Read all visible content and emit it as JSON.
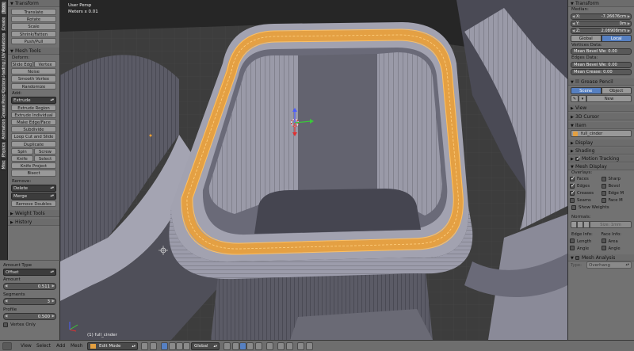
{
  "left_tabs": [
    "Tools",
    "Create",
    "Relations",
    "Shading / UVs",
    "Options",
    "Grease Pencil",
    "Animation",
    "Physics",
    "Misc"
  ],
  "shelf": {
    "transform": {
      "title": "Transform",
      "buttons": [
        "Translate",
        "Rotate",
        "Scale",
        "Shrink/Fatten",
        "Push/Pull"
      ]
    },
    "mesh_tools": {
      "title": "Mesh Tools",
      "deform_label": "Deform:",
      "slide_edge": "Slide Edg",
      "vertex": "Vertex",
      "deform_buttons": [
        "Noise",
        "Smooth Vertex",
        "Randomize"
      ],
      "add_label": "Add:",
      "extrude_select": "Extrude",
      "add_buttons": [
        "Extrude Region",
        "Extrude Individual",
        "Make Edge/Face",
        "Subdivide",
        "Loop Cut and Slide",
        "Duplicate"
      ],
      "spin": "Spin",
      "screw": "Screw",
      "knife": "Knife",
      "select": "Select",
      "add_buttons2": [
        "Knife Project",
        "Bisect"
      ],
      "remove_label": "Remove:",
      "delete_select": "Delete",
      "merge_select": "Merge",
      "remove_doubles": "Remove Doubles"
    },
    "weight_tools": "Weight Tools",
    "history": "History"
  },
  "operator": {
    "amount_type_label": "Amount Type",
    "amount_type": "Offset",
    "amount_label": "Amount",
    "amount_value": "0.511",
    "segments_label": "Segments",
    "segments_value": "3",
    "profile_label": "Profile",
    "profile_value": "0.500",
    "vertex_only": "Vertex Only"
  },
  "viewport": {
    "view_name": "User Persp",
    "scale": "Meters x 0.01",
    "object_info": "(1) full_cinder"
  },
  "rpanel": {
    "transform_title": "Transform",
    "median_label": "Median:",
    "x_label": "X:",
    "x_value": "-7.26676cm",
    "y_label": "Y:",
    "y_value": "0m",
    "z_label": "Z:",
    "z_value": "2.08908mm",
    "global": "Global",
    "local": "Local",
    "vertices_data_label": "Vertices Data:",
    "vert_bevel": "Mean Bevel We: 0.00",
    "edges_data_label": "Edges Data:",
    "edge_bevel": "Mean Bevel We: 0.00",
    "edge_crease": "Mean Crease: 0.00",
    "grease_pencil": "Grease Pencil",
    "scene": "Scene",
    "object": "Object",
    "new": "New",
    "view": "View",
    "cursor_3d": "3D Cursor",
    "item": "Item",
    "item_name": "full_cinder",
    "display": "Display",
    "shading": "Shading",
    "motion_tracking": "Motion Tracking",
    "mesh_display": "Mesh Display",
    "overlays_label": "Overlays:",
    "overlays": [
      {
        "label": "Faces",
        "checked": true
      },
      {
        "label": "Sharp",
        "checked": false
      },
      {
        "label": "Edges",
        "checked": true
      },
      {
        "label": "Bevel",
        "checked": false
      },
      {
        "label": "Creases",
        "checked": true
      },
      {
        "label": "Edge M",
        "checked": false
      },
      {
        "label": "Seams",
        "checked": false
      },
      {
        "label": "Face M",
        "checked": false
      }
    ],
    "show_weights": "Show Weights",
    "normals_label": "Normals:",
    "normals_size": "Size: 1mm",
    "edge_info_label": "Edge Info:",
    "face_info_label": "Face Info:",
    "length": "Length",
    "area": "Area",
    "angle1": "Angle",
    "angle2": "Angle",
    "mesh_analysis": "Mesh Analysis",
    "type_label": "Type:",
    "type_value": "Overhang"
  },
  "bottombar": {
    "view": "View",
    "select": "Select",
    "add": "Add",
    "mesh": "Mesh",
    "mode": "Edit Mode",
    "orientation": "Global"
  },
  "colors": {
    "selection": "#f0a030",
    "panel": "#727272",
    "viewport_bg": "#3d3d3d",
    "mesh_face": "#8f8f9e",
    "active_blue": "#5680c2"
  }
}
